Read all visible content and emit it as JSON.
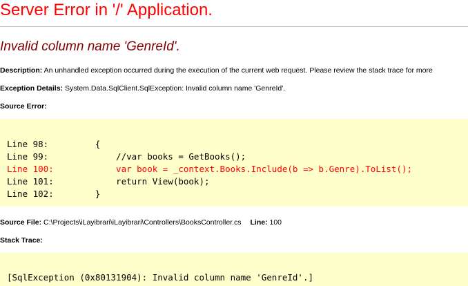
{
  "page": {
    "title": "Server Error in '/' Application.",
    "subtitle": "Invalid column name 'GenreId'."
  },
  "description": {
    "label": "Description:",
    "text": "An unhandled exception occurred during the execution of the current web request. Please review the stack trace for more"
  },
  "exception_details": {
    "label": "Exception Details:",
    "text": "System.Data.SqlClient.SqlException: Invalid column name 'GenreId'."
  },
  "source_error": {
    "label": "Source Error:",
    "lines": [
      {
        "text": "Line 98:         {"
      },
      {
        "text": "Line 99:             //var books = GetBooks();"
      },
      {
        "text": "Line 100:            var book = _context.Books.Include(b => b.Genre).ToList();",
        "highlighted": true
      },
      {
        "text": "Line 101:            return View(book);"
      },
      {
        "text": "Line 102:        }"
      }
    ]
  },
  "source_file": {
    "label": "Source File:",
    "path": "C:\\Projects\\iLayibrari\\iLayibrari\\Controllers\\BooksController.cs",
    "line_label": "Line:",
    "line_number": "100"
  },
  "stack_trace": {
    "label": "Stack Trace:",
    "first_line": "[SqlException (0x80131904): Invalid column name 'GenreId'.]"
  },
  "colors": {
    "title": "#ff0000",
    "subtitle": "#800000",
    "code_background": "#ffffcc",
    "highlight_line": "#ff0000"
  }
}
